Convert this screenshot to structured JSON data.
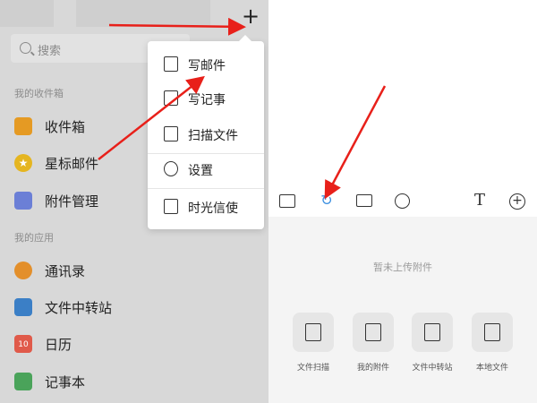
{
  "left_panel": {
    "add_icon": "plus-icon",
    "search": {
      "placeholder": "搜索"
    },
    "sections": [
      {
        "label": "我的收件箱",
        "items": [
          {
            "label": "收件箱",
            "icon": "inbox-icon"
          },
          {
            "label": "星标邮件",
            "icon": "star-icon"
          },
          {
            "label": "附件管理",
            "icon": "attachment-icon"
          }
        ]
      },
      {
        "label": "我的应用",
        "items": [
          {
            "label": "通讯录",
            "icon": "contacts-icon"
          },
          {
            "label": "文件中转站",
            "icon": "transfer-icon"
          },
          {
            "label": "日历",
            "icon": "calendar-icon",
            "badge": "10"
          },
          {
            "label": "记事本",
            "icon": "notebook-icon"
          }
        ]
      }
    ],
    "menu": {
      "items": [
        {
          "label": "写邮件",
          "icon": "compose-icon"
        },
        {
          "label": "写记事",
          "icon": "note-icon"
        },
        {
          "label": "扫描文件",
          "icon": "scan-icon"
        },
        {
          "label": "设置",
          "icon": "settings-icon"
        },
        {
          "label": "时光信使",
          "icon": "time-messenger-icon"
        }
      ]
    }
  },
  "right_panel": {
    "toolbar": [
      {
        "icon": "image-icon"
      },
      {
        "icon": "link-icon",
        "active_color": "#3b8fe0"
      },
      {
        "icon": "mail-icon"
      },
      {
        "icon": "clock-icon"
      },
      {
        "icon": "text-icon",
        "glyph": "T"
      },
      {
        "icon": "add-circle-icon",
        "glyph": "+"
      }
    ],
    "empty_text": "暂未上传附件",
    "options": [
      {
        "label": "文件扫描",
        "icon": "file-scan-icon"
      },
      {
        "label": "我的附件",
        "icon": "my-attachment-icon"
      },
      {
        "label": "文件中转站",
        "icon": "file-transfer-icon"
      },
      {
        "label": "本地文件",
        "icon": "local-folder-icon"
      }
    ]
  },
  "colors": {
    "annotation_arrow": "#e8201a",
    "accent": "#3b8fe0"
  }
}
